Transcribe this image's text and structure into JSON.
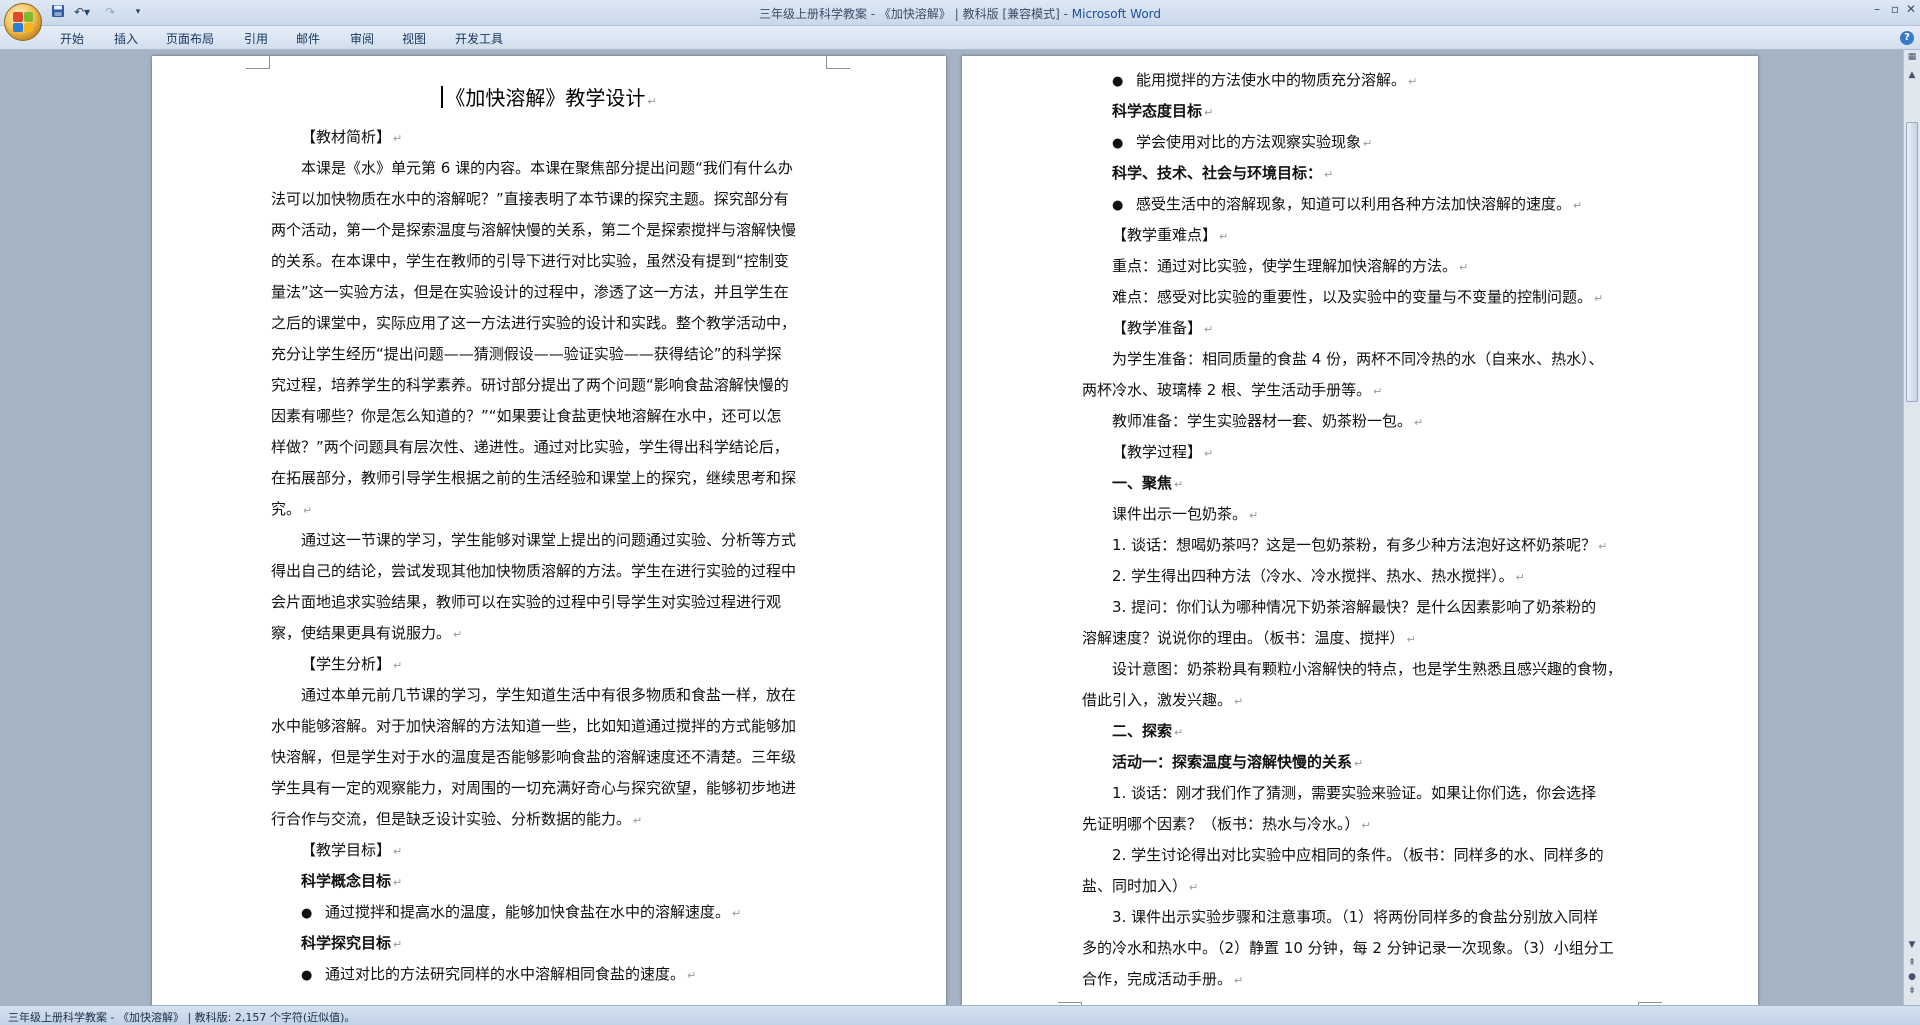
{
  "window": {
    "title": "三年级上册科学教案 - 《加快溶解》 | 教科版 [兼容模式]",
    "app_name": "Microsoft Word",
    "title_separator": " - "
  },
  "quick_access": {
    "save_icon": "save-icon",
    "undo_icon": "undo-icon",
    "redo_icon": "redo-icon",
    "customize_icon": "dropdown-icon"
  },
  "ribbon": {
    "tabs": [
      "开始",
      "插入",
      "页面布局",
      "引用",
      "邮件",
      "审阅",
      "视图",
      "开发工具"
    ]
  },
  "left_page": {
    "title": "《加快溶解》教学设计",
    "lines": [
      {
        "text": "【教材简析】",
        "cls": "",
        "indent": 30,
        "pm": true
      },
      {
        "text": "本课是《水》单元第 6 课的内容。本课在聚焦部分提出问题“我们有什么办",
        "cls": "",
        "indent": 30,
        "pm": false
      },
      {
        "text": "法可以加快物质在水中的溶解呢？”直接表明了本节课的探究主题。探究部分有",
        "cls": "",
        "indent": 0,
        "pm": false
      },
      {
        "text": "两个活动，第一个是探索温度与溶解快慢的关系，第二个是探索搅拌与溶解快慢",
        "cls": "",
        "indent": 0,
        "pm": false
      },
      {
        "text": "的关系。在本课中，学生在教师的引导下进行对比实验，虽然没有提到“控制变",
        "cls": "",
        "indent": 0,
        "pm": false
      },
      {
        "text": "量法”这一实验方法，但是在实验设计的过程中，渗透了这一方法，并且学生在",
        "cls": "",
        "indent": 0,
        "pm": false
      },
      {
        "text": "之后的课堂中，实际应用了这一方法进行实验的设计和实践。整个教学活动中，",
        "cls": "",
        "indent": 0,
        "pm": false
      },
      {
        "text": "充分让学生经历“提出问题——猜测假设——验证实验——获得结论”的科学探",
        "cls": "",
        "indent": 0,
        "pm": false
      },
      {
        "text": "究过程，培养学生的科学素养。研讨部分提出了两个问题“影响食盐溶解快慢的",
        "cls": "",
        "indent": 0,
        "pm": false
      },
      {
        "text": "因素有哪些？你是怎么知道的？”“如果要让食盐更快地溶解在水中，还可以怎",
        "cls": "",
        "indent": 0,
        "pm": false
      },
      {
        "text": "样做？”两个问题具有层次性、递进性。通过对比实验，学生得出科学结论后，",
        "cls": "",
        "indent": 0,
        "pm": false
      },
      {
        "text": "在拓展部分，教师引导学生根据之前的生活经验和课堂上的探究，继续思考和探",
        "cls": "",
        "indent": 0,
        "pm": false
      },
      {
        "text": "究。",
        "cls": "",
        "indent": 0,
        "pm": true
      },
      {
        "text": "通过这一节课的学习，学生能够对课堂上提出的问题通过实验、分析等方式",
        "cls": "",
        "indent": 30,
        "pm": false
      },
      {
        "text": "得出自己的结论，尝试发现其他加快物质溶解的方法。学生在进行实验的过程中",
        "cls": "",
        "indent": 0,
        "pm": false
      },
      {
        "text": "会片面地追求实验结果，教师可以在实验的过程中引导学生对实验过程进行观",
        "cls": "",
        "indent": 0,
        "pm": false
      },
      {
        "text": "察，使结果更具有说服力。",
        "cls": "",
        "indent": 0,
        "pm": true
      },
      {
        "text": "【学生分析】",
        "cls": "",
        "indent": 30,
        "pm": true
      },
      {
        "text": "通过本单元前几节课的学习，学生知道生活中有很多物质和食盐一样，放在",
        "cls": "",
        "indent": 30,
        "pm": false
      },
      {
        "text": "水中能够溶解。对于加快溶解的方法知道一些，比如知道通过搅拌的方式能够加",
        "cls": "",
        "indent": 0,
        "pm": false
      },
      {
        "text": "快溶解，但是学生对于水的温度是否能够影响食盐的溶解速度还不清楚。三年级",
        "cls": "",
        "indent": 0,
        "pm": false
      },
      {
        "text": "学生具有一定的观察能力，对周围的一切充满好奇心与探究欲望，能够初步地进",
        "cls": "",
        "indent": 0,
        "pm": false
      },
      {
        "text": "行合作与交流，但是缺乏设计实验、分析数据的能力。",
        "cls": "",
        "indent": 0,
        "pm": true
      },
      {
        "text": "【教学目标】",
        "cls": "",
        "indent": 30,
        "pm": true
      },
      {
        "text": "科学概念目标",
        "cls": "b",
        "indent": 30,
        "pm": true
      },
      {
        "text": "通过搅拌和提高水的温度，能够加快食盐在水中的溶解速度。",
        "cls": "bullet",
        "indent": 30,
        "pm": true
      },
      {
        "text": "科学探究目标",
        "cls": "b",
        "indent": 30,
        "pm": true
      },
      {
        "text": "通过对比的方法研究同样的水中溶解相同食盐的速度。",
        "cls": "bullet",
        "indent": 30,
        "pm": true
      }
    ]
  },
  "right_page": {
    "lines": [
      {
        "text": "能用搅拌的方法使水中的物质充分溶解。",
        "cls": "bullet",
        "indent": 30,
        "pm": true
      },
      {
        "text": "科学态度目标",
        "cls": "b",
        "indent": 30,
        "pm": true
      },
      {
        "text": "学会使用对比的方法观察实验现象",
        "cls": "bullet",
        "indent": 30,
        "pm": true
      },
      {
        "text": "科学、技术、社会与环境目标：",
        "cls": "b",
        "indent": 30,
        "pm": true
      },
      {
        "text": "感受生活中的溶解现象，知道可以利用各种方法加快溶解的速度。",
        "cls": "bullet",
        "indent": 30,
        "pm": true
      },
      {
        "text": "【教学重难点】",
        "cls": "",
        "indent": 30,
        "pm": true
      },
      {
        "text": "重点：通过对比实验，使学生理解加快溶解的方法。",
        "cls": "",
        "indent": 30,
        "pm": true
      },
      {
        "text": "难点：感受对比实验的重要性，以及实验中的变量与不变量的控制问题。",
        "cls": "",
        "indent": 30,
        "pm": true
      },
      {
        "text": "【教学准备】",
        "cls": "",
        "indent": 30,
        "pm": true
      },
      {
        "text": "为学生准备：相同质量的食盐 4 份，两杯不同冷热的水（自来水、热水）、",
        "cls": "",
        "indent": 30,
        "pm": false
      },
      {
        "text": "两杯冷水、玻璃棒 2 根、学生活动手册等。",
        "cls": "",
        "indent": 0,
        "pm": true
      },
      {
        "text": "教师准备：学生实验器材一套、奶茶粉一包。",
        "cls": "",
        "indent": 30,
        "pm": true
      },
      {
        "text": "【教学过程】",
        "cls": "",
        "indent": 30,
        "pm": true
      },
      {
        "text": "一、聚焦",
        "cls": "b",
        "indent": 30,
        "pm": true
      },
      {
        "text": "课件出示一包奶茶。",
        "cls": "",
        "indent": 30,
        "pm": true
      },
      {
        "text": "1. 谈话：想喝奶茶吗？这是一包奶茶粉，有多少种方法泡好这杯奶茶呢？",
        "cls": "",
        "indent": 30,
        "pm": true
      },
      {
        "text": "2. 学生得出四种方法（冷水、冷水搅拌、热水、热水搅拌）。",
        "cls": "",
        "indent": 30,
        "pm": true
      },
      {
        "text": "3. 提问：你们认为哪种情况下奶茶溶解最快？是什么因素影响了奶茶粉的",
        "cls": "",
        "indent": 30,
        "pm": false
      },
      {
        "text": "溶解速度？说说你的理由。（板书：温度、搅拌）",
        "cls": "",
        "indent": 0,
        "pm": true
      },
      {
        "text": "设计意图：奶茶粉具有颗粒小溶解快的特点，也是学生熟悉且感兴趣的食物，",
        "cls": "",
        "indent": 30,
        "pm": false
      },
      {
        "text": "借此引入，激发兴趣。",
        "cls": "",
        "indent": 0,
        "pm": true
      },
      {
        "text": "二、探索",
        "cls": "b",
        "indent": 30,
        "pm": true
      },
      {
        "text": "活动一：探索温度与溶解快慢的关系",
        "cls": "b",
        "indent": 30,
        "pm": true
      },
      {
        "text": "1. 谈话：刚才我们作了猜测，需要实验来验证。如果让你们选，你会选择",
        "cls": "",
        "indent": 30,
        "pm": false
      },
      {
        "text": "先证明哪个因素？（板书：热水与冷水。）",
        "cls": "",
        "indent": 0,
        "pm": true
      },
      {
        "text": "2. 学生讨论得出对比实验中应相同的条件。（板书：同样多的水、同样多的",
        "cls": "",
        "indent": 30,
        "pm": false
      },
      {
        "text": "盐、同时加入）",
        "cls": "",
        "indent": 0,
        "pm": true
      },
      {
        "text": "3. 课件出示实验步骤和注意事项。（1）将两份同样多的食盐分别放入同样",
        "cls": "",
        "indent": 30,
        "pm": false
      },
      {
        "text": "多的冷水和热水中。（2）静置 10 分钟，每 2 分钟记录一次现象。（3）小组分工",
        "cls": "",
        "indent": 0,
        "pm": false
      },
      {
        "text": "合作，完成活动手册。",
        "cls": "",
        "indent": 0,
        "pm": true
      }
    ]
  },
  "paragraph_mark": "↵",
  "status": {
    "text": "三年级上册科学教案 - 《加快溶解》 | 教科版: 2,157 个字符(近似值)。"
  },
  "colors": {
    "title_bar": "#dbe6f4",
    "app_name": "#1f4f9c",
    "doc_background": "#a5b3c5",
    "page": "#ffffff"
  }
}
